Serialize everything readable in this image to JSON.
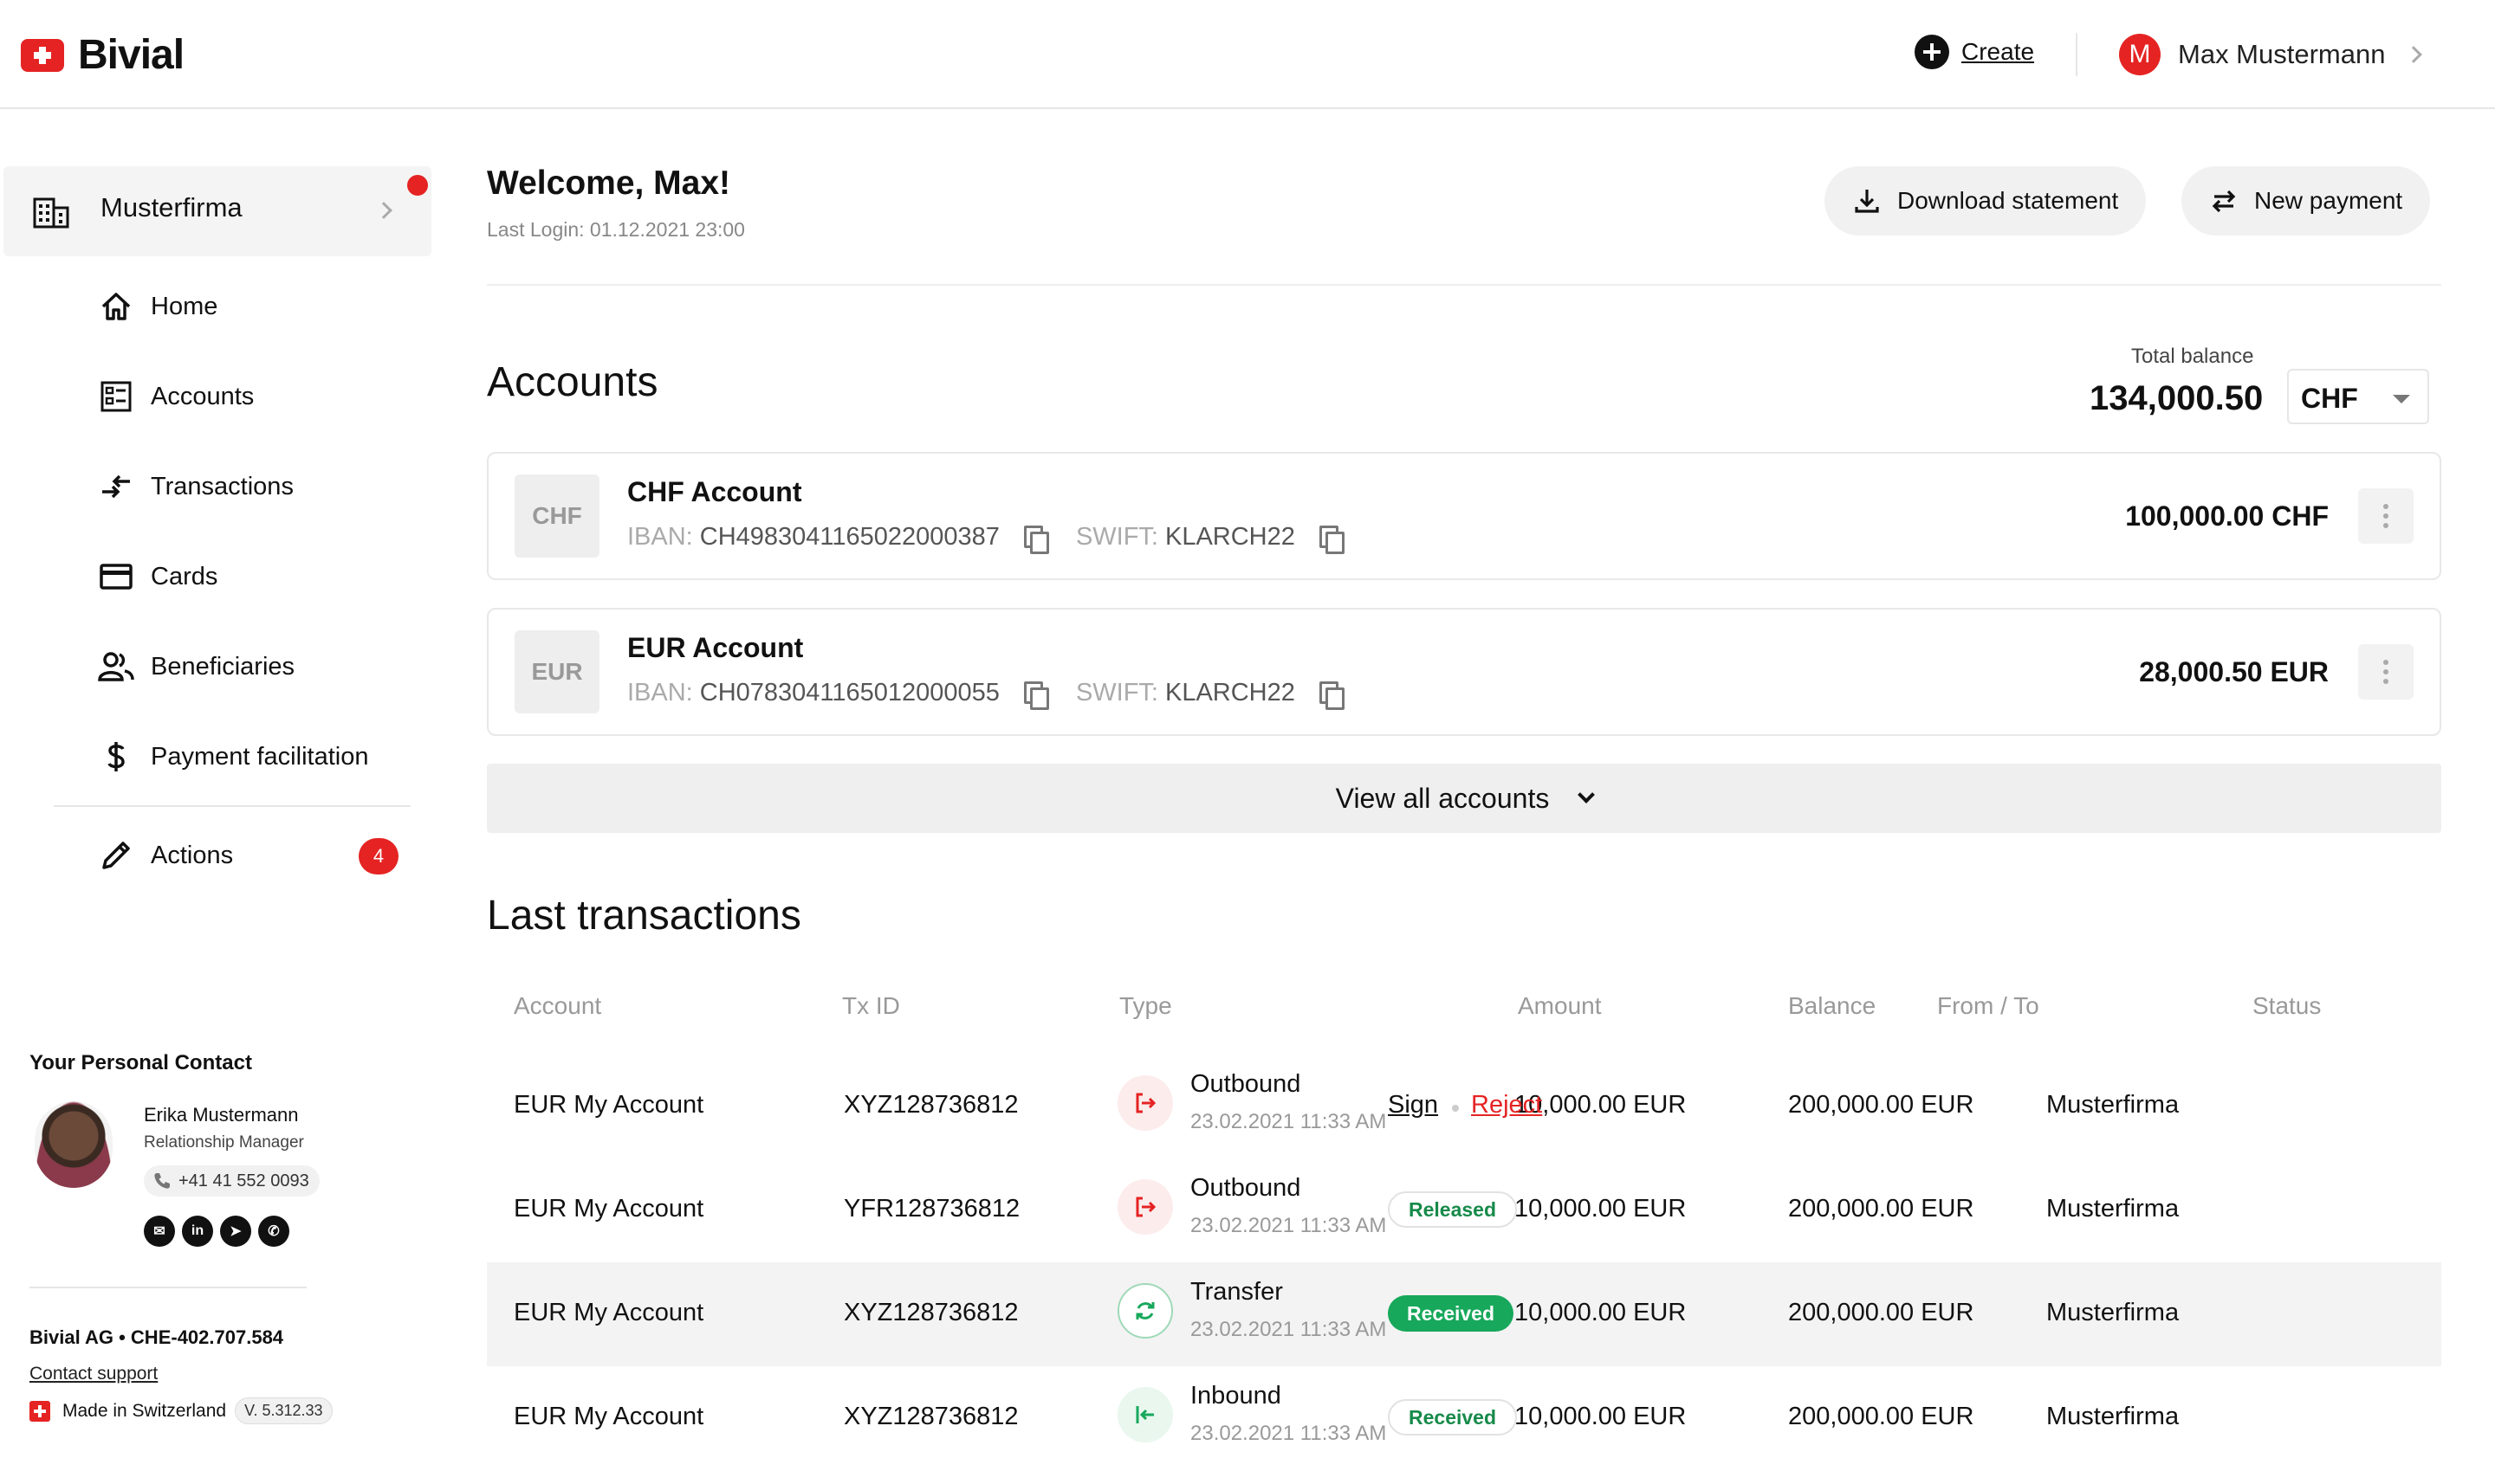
{
  "header": {
    "brand": "Bivial",
    "create_label": "Create",
    "user_initial": "M",
    "user_name": "Max Mustermann"
  },
  "sidebar": {
    "org_name": "Musterfirma",
    "items": [
      {
        "label": "Home",
        "icon": "home-icon"
      },
      {
        "label": "Accounts",
        "icon": "accounts-icon"
      },
      {
        "label": "Transactions",
        "icon": "transactions-icon"
      },
      {
        "label": "Cards",
        "icon": "card-icon"
      },
      {
        "label": "Beneficiaries",
        "icon": "beneficiaries-icon"
      },
      {
        "label": "Payment facilitation",
        "icon": "dollar-icon"
      },
      {
        "label": "Actions",
        "icon": "pencil-icon",
        "badge": "4"
      }
    ],
    "contact": {
      "title": "Your Personal Contact",
      "name": "Erika Mustermann",
      "role": "Relationship Manager",
      "phone": "+41 41 552 0093",
      "socials": [
        "email-icon",
        "linkedin-icon",
        "telegram-icon",
        "whatsapp-icon"
      ]
    },
    "footer": {
      "company": "Bivial AG  •  CHE-402.707.584",
      "support": "Contact support",
      "made_in": "Made in Switzerland",
      "version": "V. 5.312.33"
    }
  },
  "main": {
    "welcome": "Welcome, Max!",
    "last_login": "Last Login: 01.12.2021 23:00",
    "download_label": "Download statement",
    "new_payment_label": "New payment",
    "accounts_title": "Accounts",
    "total_balance_label": "Total balance",
    "total_balance_value": "134,000.50",
    "currency": "CHF",
    "accounts": [
      {
        "badge": "CHF",
        "name": "CHF Account",
        "iban_label": "IBAN:",
        "iban": "CH4983041165022000387",
        "swift_label": "SWIFT:",
        "swift": "KLARCH22",
        "amount": "100,000.00 CHF"
      },
      {
        "badge": "EUR",
        "name": "EUR Account",
        "iban_label": "IBAN:",
        "iban": "CH0783041165012000055",
        "swift_label": "SWIFT:",
        "swift": "KLARCH22",
        "amount": "28,000.50 EUR"
      }
    ],
    "view_all_label": "View all accounts",
    "transactions_title": "Last transactions",
    "columns": [
      "Account",
      "Tx ID",
      "Type",
      "Amount",
      "Balance",
      "From / To",
      "Status"
    ],
    "transactions": [
      {
        "account": "EUR My Account",
        "tx_id": "XYZ128736812",
        "type": "Outbound",
        "date": "23.02.2021 11:33 AM",
        "amount": "10,000.00 EUR",
        "balance": "200,000.00 EUR",
        "from_to": "Musterfirma",
        "status": "",
        "sign": "Sign",
        "reject": "Reject"
      },
      {
        "account": "EUR My Account",
        "tx_id": "YFR128736812",
        "type": "Outbound",
        "date": "23.02.2021 11:33 AM",
        "amount": "10,000.00 EUR",
        "balance": "200,000.00 EUR",
        "from_to": "Musterfirma",
        "status": "Released"
      },
      {
        "account": "EUR My Account",
        "tx_id": "XYZ128736812",
        "type": "Transfer",
        "date": "23.02.2021 11:33 AM",
        "amount": "10,000.00 EUR",
        "balance": "200,000.00 EUR",
        "from_to": "Musterfirma",
        "status": "Received"
      },
      {
        "account": "EUR My Account",
        "tx_id": "XYZ128736812",
        "type": "Inbound",
        "date": "23.02.2021 11:33 AM",
        "amount": "10,000.00 EUR",
        "balance": "200,000.00 EUR",
        "from_to": "Musterfirma",
        "status": "Received"
      }
    ]
  },
  "colors": {
    "brand_red": "#e52323",
    "success_green": "#17a85b"
  }
}
